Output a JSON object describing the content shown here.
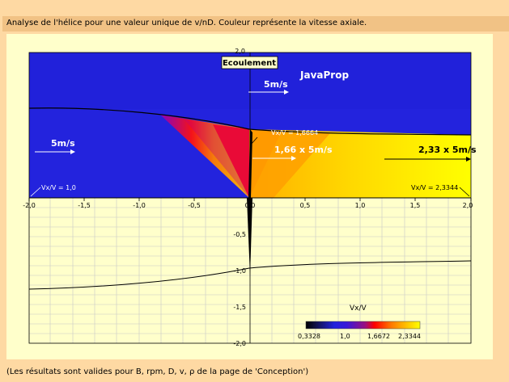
{
  "header": {
    "title": "Analyse de l'hélice pour une valeur unique de v/nD. Couleur représente la vitesse axiale."
  },
  "footer": {
    "note": "(Les résultats sont valides pour B, rpm, D, v, ρ de la page de 'Conception')"
  },
  "plot": {
    "label_flow": "Ecoulement",
    "brand": "JavaProp",
    "arrow_scale": "5m/s",
    "arrow_left": "5m/s",
    "arrow_mid": "1,66 x 5m/s",
    "arrow_right": "2,33 x 5m/s",
    "vx_left": "Vx/V = 1,0",
    "vx_right": "Vx/V = 2,3344",
    "vx_disk": "Vx/V = 1,6664",
    "x_ticks": [
      "-2,0",
      "-1,5",
      "-1,0",
      "-0,5",
      "0,0",
      "0,5",
      "1,0",
      "1,5",
      "2,0"
    ],
    "y_tick_top": "2,0",
    "y_ticks_neg": [
      "-0,5",
      "-1,0",
      "-1,5",
      "-2,0"
    ],
    "colorbar": {
      "title": "Vx/V",
      "labels": [
        "0,3328",
        "1,0",
        "1,6672",
        "2,3344"
      ],
      "colors": [
        "#000000",
        "#1a0a60",
        "#2a10b0",
        "#2020e0",
        "#4010d0",
        "#8010a0",
        "#c01060",
        "#ff0000",
        "#ff6000",
        "#ffa000",
        "#ffd000",
        "#ffff00"
      ]
    }
  }
}
